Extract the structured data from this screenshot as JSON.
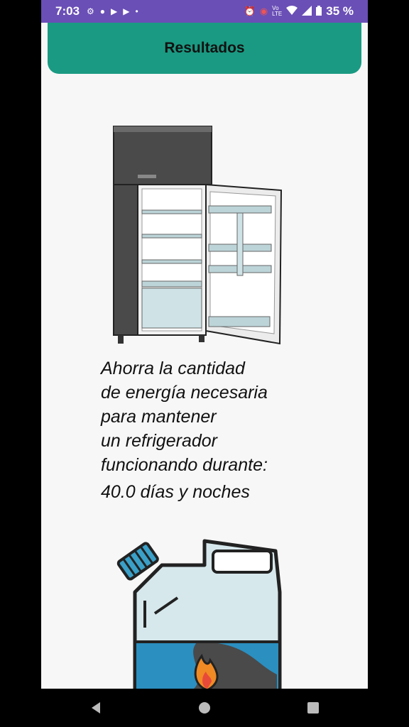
{
  "status_bar": {
    "time": "7:03",
    "battery": "35 %",
    "icons": [
      "settings-icon",
      "chat-icon",
      "youtube-icon",
      "youtube-icon",
      "dot-icon",
      "alarm-icon",
      "record-icon",
      "volte-icon",
      "wifi-icon",
      "signal-icon",
      "battery-icon"
    ]
  },
  "header": {
    "title": "Resultados"
  },
  "message": {
    "lines": [
      "Ahorra la cantidad",
      "de energía necesaria",
      "para mantener",
      "un refrigerador",
      "funcionando durante:"
    ],
    "result": "40.0 días y noches"
  },
  "images": {
    "top": "refrigerator-illustration",
    "bottom": "fuel-jerrycan-illustration"
  },
  "colors": {
    "header": "#1a9a82",
    "status_bar": "#6a4fb6",
    "background": "#f7f7f7"
  },
  "nav": {
    "buttons": [
      "back-icon",
      "home-icon",
      "recents-icon"
    ]
  }
}
